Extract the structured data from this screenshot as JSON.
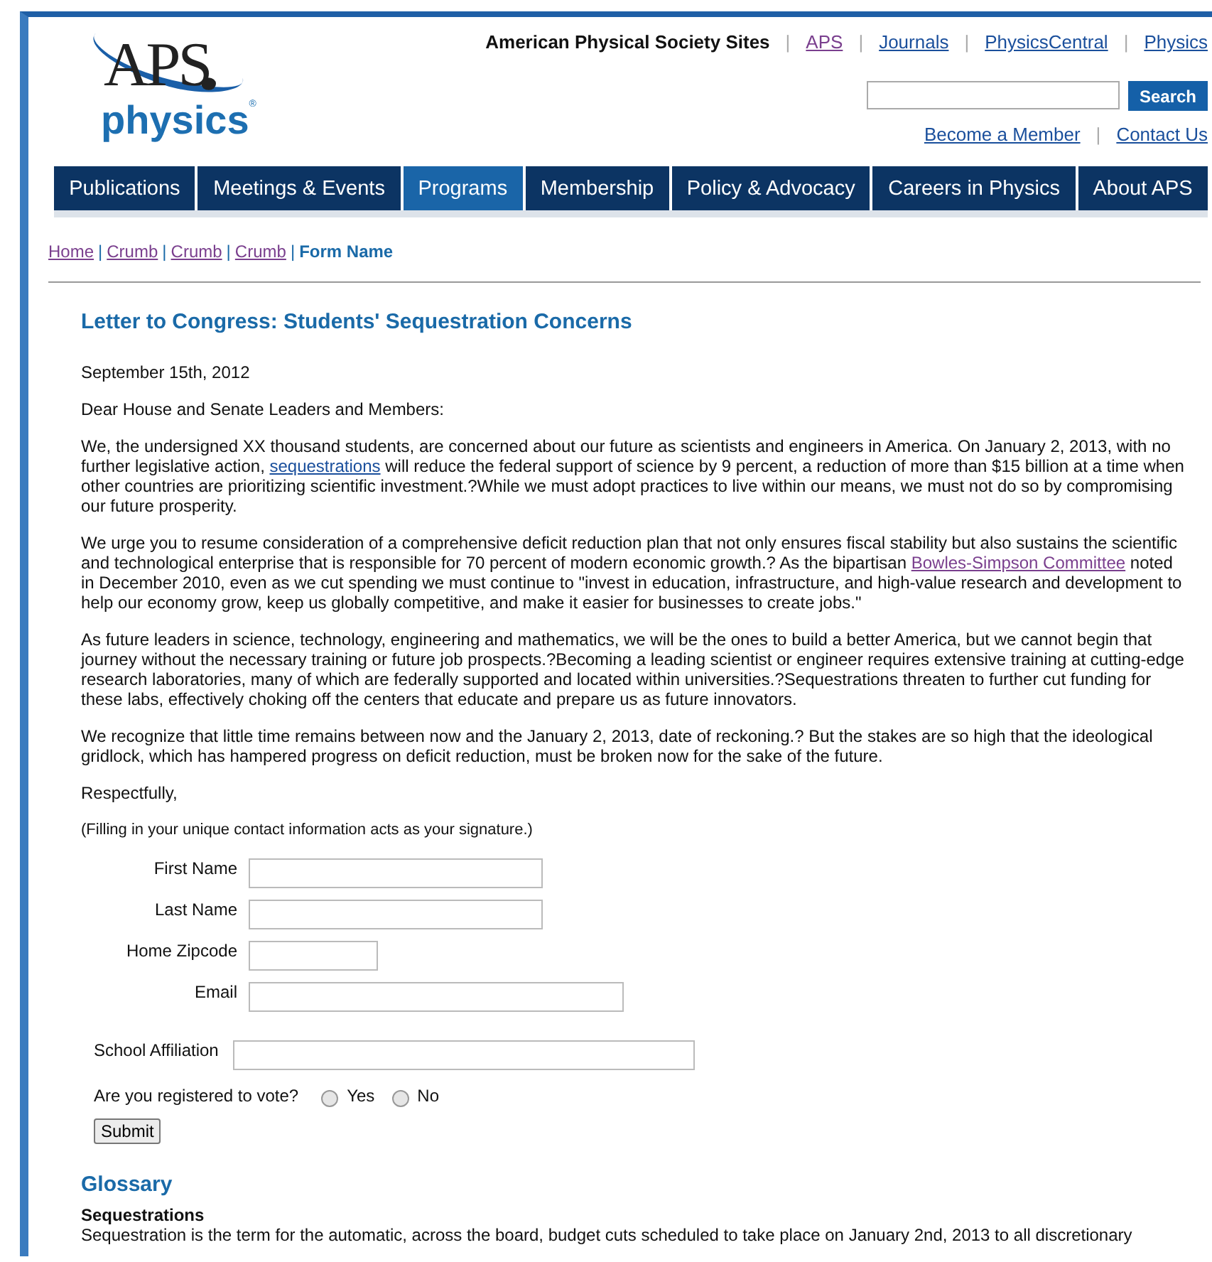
{
  "logo": {
    "letters": "APS",
    "word": "physics",
    "mark": "®"
  },
  "sites": {
    "label": "American Physical Society Sites",
    "separator": "|",
    "links": [
      {
        "text": "APS",
        "visited": true
      },
      {
        "text": "Journals",
        "visited": false
      },
      {
        "text": "PhysicsCentral",
        "visited": false
      },
      {
        "text": "Physics",
        "visited": false
      }
    ]
  },
  "search": {
    "button": "Search"
  },
  "account_separator": "|",
  "account_links": [
    {
      "text": "Become a Member",
      "visited": false
    },
    {
      "text": "Contact Us",
      "visited": false
    }
  ],
  "nav": [
    {
      "label": "Publications",
      "selected": false
    },
    {
      "label": "Meetings & Events",
      "selected": false
    },
    {
      "label": "Programs",
      "selected": true
    },
    {
      "label": "Membership",
      "selected": false
    },
    {
      "label": "Policy & Advocacy",
      "selected": false
    },
    {
      "label": "Careers in Physics",
      "selected": false
    },
    {
      "label": "About APS",
      "selected": false
    }
  ],
  "breadcrumb_separator": "|",
  "breadcrumb": [
    {
      "text": "Home",
      "kind": "link"
    },
    {
      "text": "Crumb",
      "kind": "link"
    },
    {
      "text": "Crumb",
      "kind": "link"
    },
    {
      "text": "Crumb",
      "kind": "link"
    },
    {
      "text": "Form Name",
      "kind": "current"
    }
  ],
  "title": "Letter to Congress: Students' Sequestration Concerns",
  "paragraphs": [
    {
      "kind": "plain",
      "parts": [
        {
          "text": "September 15th, 2012"
        }
      ]
    },
    {
      "kind": "plain",
      "parts": [
        {
          "text": "Dear House and Senate Leaders and Members:"
        }
      ]
    },
    {
      "kind": "plain",
      "parts": [
        {
          "text": "We, the undersigned XX thousand students, are concerned about our future as scientists and engineers in America. On January 2, 2013, with no further legislative action, "
        },
        {
          "text": "sequestrations",
          "link": true,
          "visited": false
        },
        {
          "text": " will reduce the federal support of science by 9 percent, a reduction of more than $15 billion at a time when other countries are prioritizing scientific investment.?While we must adopt practices to live within our means, we must not do so by compromising our future prosperity."
        }
      ]
    },
    {
      "kind": "plain",
      "parts": [
        {
          "text": "We urge you to resume consideration of a comprehensive deficit reduction plan that not only ensures fiscal stability but also sustains the scientific and technological enterprise that is responsible for 70 percent of modern economic growth.? As the bipartisan "
        },
        {
          "text": "Bowles-Simpson Committee",
          "link": true,
          "visited": true
        },
        {
          "text": " noted in December 2010, even as we cut spending we must continue to \"invest in education, infrastructure, and high-value research and development to help our economy grow, keep us globally competitive, and make it easier for businesses to create jobs.\""
        }
      ]
    },
    {
      "kind": "plain",
      "parts": [
        {
          "text": "As future leaders in science, technology, engineering and mathematics, we will be the ones to build a better America, but we cannot begin that journey without the necessary training or future job prospects.?Becoming a leading scientist or engineer requires extensive training at cutting-edge research laboratories, many of which are federally supported and located within universities.?Sequestrations threaten to further cut funding for these labs, effectively choking off the centers that educate and prepare us as future innovators."
        }
      ]
    },
    {
      "kind": "plain",
      "parts": [
        {
          "text": "We recognize that little time remains between now and the January 2, 2013, date of reckoning.? But the stakes are so high that the ideological gridlock, which has hampered progress on deficit reduction, must be broken now for the sake of the future."
        }
      ]
    },
    {
      "kind": "plain",
      "parts": [
        {
          "text": "Respectfully,"
        }
      ]
    },
    {
      "kind": "note",
      "parts": [
        {
          "text": "(Filling in your unique contact information acts as your signature.)"
        }
      ]
    }
  ],
  "fields": [
    {
      "label": "First Name",
      "kind": "medium"
    },
    {
      "label": "Last Name",
      "kind": "medium"
    },
    {
      "label": "Home Zipcode",
      "kind": "short"
    },
    {
      "label": "Email",
      "kind": "long"
    }
  ],
  "school": {
    "label": "School Affiliation"
  },
  "vote": {
    "question": "Are you registered to vote?",
    "options": [
      {
        "label": "Yes",
        "selected": false
      },
      {
        "label": "No",
        "selected": false
      }
    ]
  },
  "submit": "Submit",
  "glossary": {
    "heading": "Glossary",
    "term": "Sequestrations",
    "definition": "Sequestration is the term for the automatic, across the board, budget cuts scheduled to take place on January 2nd, 2013 to all discretionary"
  }
}
